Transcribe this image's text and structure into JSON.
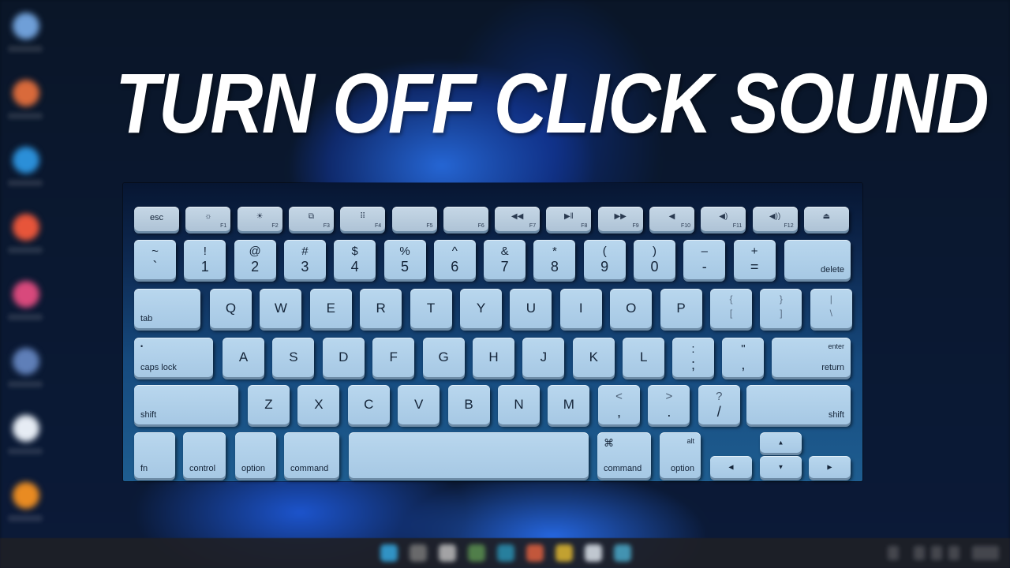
{
  "headline": "TURN OFF CLICK SOUND",
  "desktop_icons": [
    {
      "name": "recycle-bin",
      "color": "#6f9fd8"
    },
    {
      "name": "chrome",
      "color": "#d96a3b"
    },
    {
      "name": "edge",
      "color": "#2b8fd8"
    },
    {
      "name": "brave",
      "color": "#e7553a"
    },
    {
      "name": "photos",
      "color": "#d8497c"
    },
    {
      "name": "app",
      "color": "#5f7fb8"
    },
    {
      "name": "document",
      "color": "#e6ecf4"
    },
    {
      "name": "vlc",
      "color": "#e98b22"
    }
  ],
  "taskbar": {
    "apps": [
      {
        "name": "start",
        "color": "#35a8e0"
      },
      {
        "name": "search",
        "color": "#777"
      },
      {
        "name": "task-view",
        "color": "#bbb"
      },
      {
        "name": "chrome",
        "color": "#5a8f4f"
      },
      {
        "name": "edge",
        "color": "#2a8fb0"
      },
      {
        "name": "brave",
        "color": "#e0603e"
      },
      {
        "name": "file-explorer",
        "color": "#e0b830"
      },
      {
        "name": "notepad",
        "color": "#dde4ec"
      },
      {
        "name": "store",
        "color": "#4aa8c8"
      }
    ]
  },
  "keyboard": {
    "frow": [
      {
        "id": "esc",
        "label": "esc"
      },
      {
        "id": "f1",
        "icon": "☼",
        "fn": "F1"
      },
      {
        "id": "f2",
        "icon": "☀",
        "fn": "F2"
      },
      {
        "id": "f3",
        "icon": "⧉",
        "fn": "F3"
      },
      {
        "id": "f4",
        "icon": "⠿",
        "fn": "F4"
      },
      {
        "id": "f5",
        "icon": "",
        "fn": "F5"
      },
      {
        "id": "f6",
        "icon": "",
        "fn": "F6"
      },
      {
        "id": "f7",
        "icon": "◀◀",
        "fn": "F7"
      },
      {
        "id": "f8",
        "icon": "▶‖",
        "fn": "F8"
      },
      {
        "id": "f9",
        "icon": "▶▶",
        "fn": "F9"
      },
      {
        "id": "f10",
        "icon": "◀",
        "fn": "F10"
      },
      {
        "id": "f11",
        "icon": "◀)",
        "fn": "F11"
      },
      {
        "id": "f12",
        "icon": "◀))",
        "fn": "F12"
      },
      {
        "id": "eject",
        "icon": "⏏",
        "fn": ""
      }
    ],
    "nrow": [
      {
        "top": "~",
        "bot": "`"
      },
      {
        "top": "!",
        "bot": "1"
      },
      {
        "top": "@",
        "bot": "2"
      },
      {
        "top": "#",
        "bot": "3"
      },
      {
        "top": "$",
        "bot": "4"
      },
      {
        "top": "%",
        "bot": "5"
      },
      {
        "top": "^",
        "bot": "6"
      },
      {
        "top": "&",
        "bot": "7"
      },
      {
        "top": "*",
        "bot": "8"
      },
      {
        "top": "(",
        "bot": "9"
      },
      {
        "top": ")",
        "bot": "0"
      },
      {
        "top": "–",
        "bot": "-"
      },
      {
        "top": "+",
        "bot": "="
      }
    ],
    "delete": "delete",
    "tab": "tab",
    "qrow": [
      "Q",
      "W",
      "E",
      "R",
      "T",
      "Y",
      "U",
      "I",
      "O",
      "P"
    ],
    "qrow_sym": [
      {
        "top": "{",
        "bot": "["
      },
      {
        "top": "}",
        "bot": "]"
      },
      {
        "top": "|",
        "bot": "\\"
      }
    ],
    "caps": "caps lock",
    "caps_dot": "•",
    "arow": [
      "A",
      "S",
      "D",
      "F",
      "G",
      "H",
      "J",
      "K",
      "L"
    ],
    "arow_sym": [
      {
        "top": ":",
        "bot": ";"
      },
      {
        "top": "\"",
        "bot": ","
      }
    ],
    "enter": "enter",
    "return": "return",
    "shift_left": "shift",
    "zrow": [
      "Z",
      "X",
      "C",
      "V",
      "B",
      "N",
      "M"
    ],
    "zrow_sym": [
      {
        "top": "<",
        "bot": ","
      },
      {
        "top": ">",
        "bot": "."
      },
      {
        "top": "?",
        "bot": "/"
      }
    ],
    "shift_right": "shift",
    "fn": "fn",
    "control": "control",
    "option_left": "option",
    "command_left": "command",
    "command_right": "command",
    "command_symbol": "⌘",
    "option_right": "option",
    "alt": "alt",
    "arrows": {
      "up": "▲",
      "down": "▼",
      "left": "◀",
      "right": "▶"
    }
  }
}
